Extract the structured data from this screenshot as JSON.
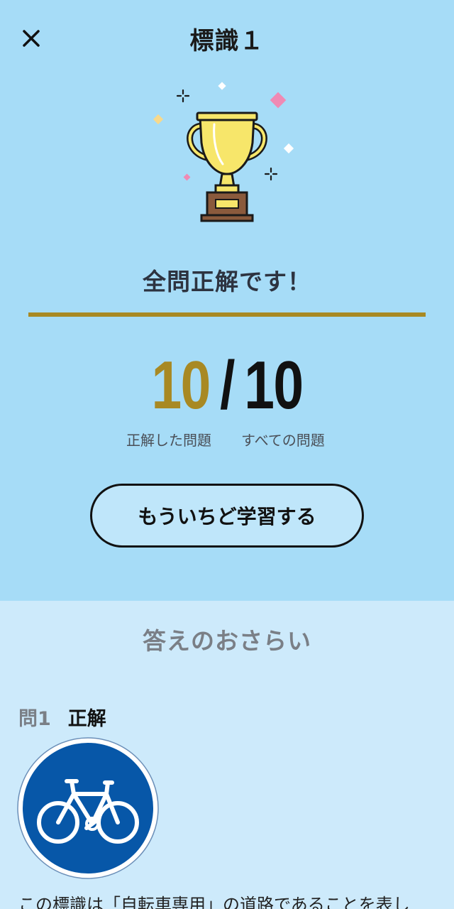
{
  "header": {
    "title": "標識１",
    "close_icon": "close-icon"
  },
  "result": {
    "message": "全問正解です！",
    "correct_count": "10",
    "separator": "/",
    "total_count": "10",
    "correct_label": "正解した問題",
    "total_label": "すべての問題",
    "retry_label": "もういちど学習する"
  },
  "review": {
    "title": "答えのおさらい",
    "questions": [
      {
        "number": "問1",
        "result": "正解",
        "sign_icon": "bicycle-only-sign",
        "explanation": "この標識は「自転車専用」の道路であることを表し"
      }
    ]
  },
  "colors": {
    "top_background": "#a6dcf7",
    "bottom_background": "#cdeafb",
    "accent_gold": "#a88923",
    "sign_blue": "#0757a8",
    "trophy_yellow": "#f7e66a"
  }
}
